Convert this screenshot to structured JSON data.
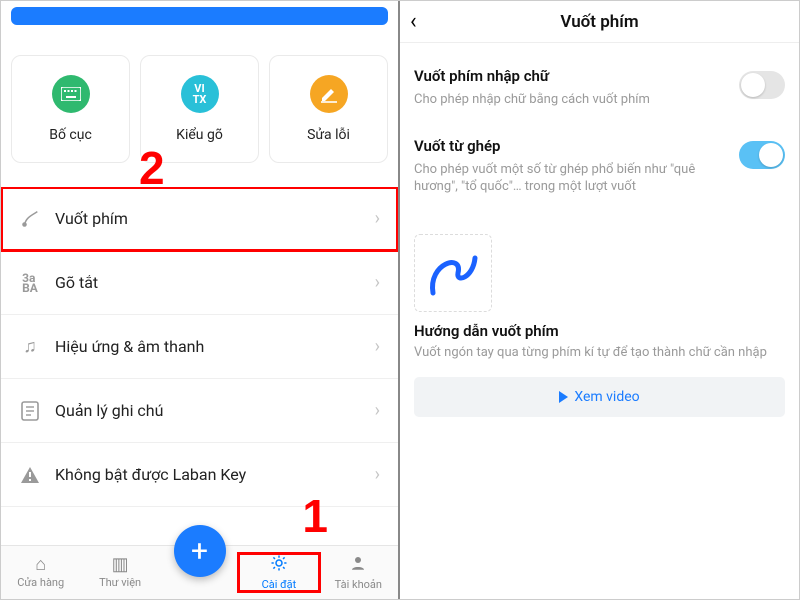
{
  "left": {
    "cards": [
      {
        "label": "Bố cục"
      },
      {
        "label": "Kiểu gõ"
      },
      {
        "label": "Sửa lỗi"
      }
    ],
    "rows": [
      {
        "label": "Vuốt phím"
      },
      {
        "label": "Gõ tắt"
      },
      {
        "label": "Hiệu ứng & âm thanh"
      },
      {
        "label": "Quản lý ghi chú"
      },
      {
        "label": "Không bật được Laban Key"
      }
    ],
    "tabs": [
      {
        "label": "Cửa hàng"
      },
      {
        "label": "Thư viện"
      },
      {
        "label": ""
      },
      {
        "label": "Cài đặt"
      },
      {
        "label": "Tài khoản"
      }
    ],
    "annotations": {
      "one": "1",
      "two": "2"
    }
  },
  "right": {
    "title": "Vuốt phím",
    "settings": [
      {
        "title": "Vuốt phím nhập chữ",
        "desc": "Cho phép nhập chữ bằng cách vuốt phím",
        "on": false
      },
      {
        "title": "Vuốt từ ghép",
        "desc": "Cho phép vuốt một số từ ghép phổ biến như \"quê hương\", \"tổ quốc\"… trong một lượt vuốt",
        "on": true
      }
    ],
    "guide": {
      "title": "Hướng dẫn vuốt phím",
      "desc": "Vuốt ngón tay qua từng phím kí tự để tạo thành chữ cần nhập",
      "button": "Xem video"
    }
  }
}
